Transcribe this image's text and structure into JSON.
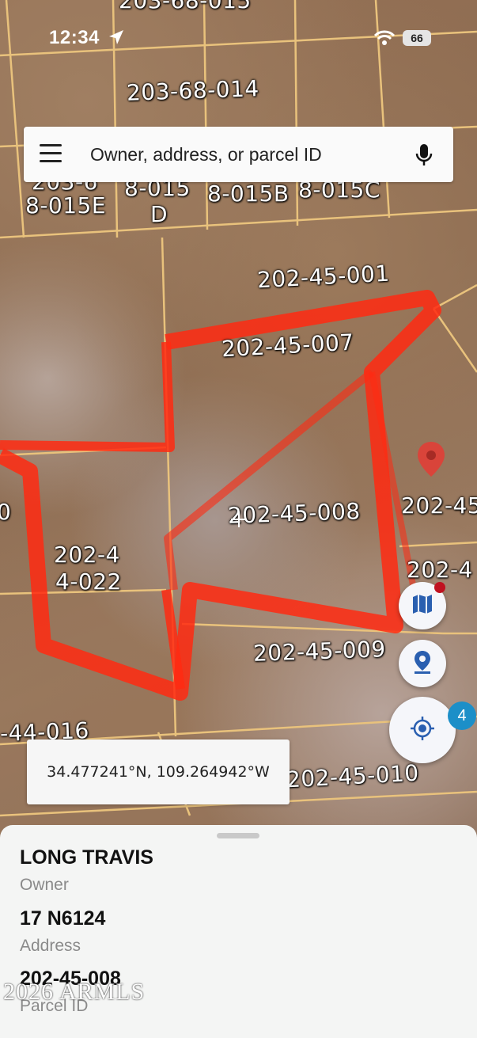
{
  "status_bar": {
    "time": "12:34",
    "battery": "66"
  },
  "search": {
    "placeholder": "Owner, address, or parcel ID"
  },
  "map": {
    "parcel_labels": [
      "203-68-015",
      "203-68-014",
      "203-6",
      "8-015E",
      "8-015",
      "D",
      "8-015B",
      "8-015C",
      "202-45-001",
      "202-45-007",
      "202-45-008",
      "202-4",
      "4-022",
      "202-45",
      "202-4",
      "202-45-009",
      "-44-016",
      "202-45-010",
      "0"
    ],
    "boundary_color": "#ff2a12",
    "line_color": "#e9c27c",
    "notification_count": "4"
  },
  "coordinates": {
    "text": "34.477241°N, 109.264942°W"
  },
  "details": {
    "owner_value": "LONG TRAVIS",
    "owner_label": "Owner",
    "address_value": "17 N6124",
    "address_label": "Address",
    "parcel_value": "202-45-008",
    "parcel_label": "Parcel ID"
  },
  "watermark": "2026 ARMLS",
  "colors": {
    "badge": "#1c8fc8",
    "accent": "#2a5fb0",
    "pin": "#d9443a"
  }
}
